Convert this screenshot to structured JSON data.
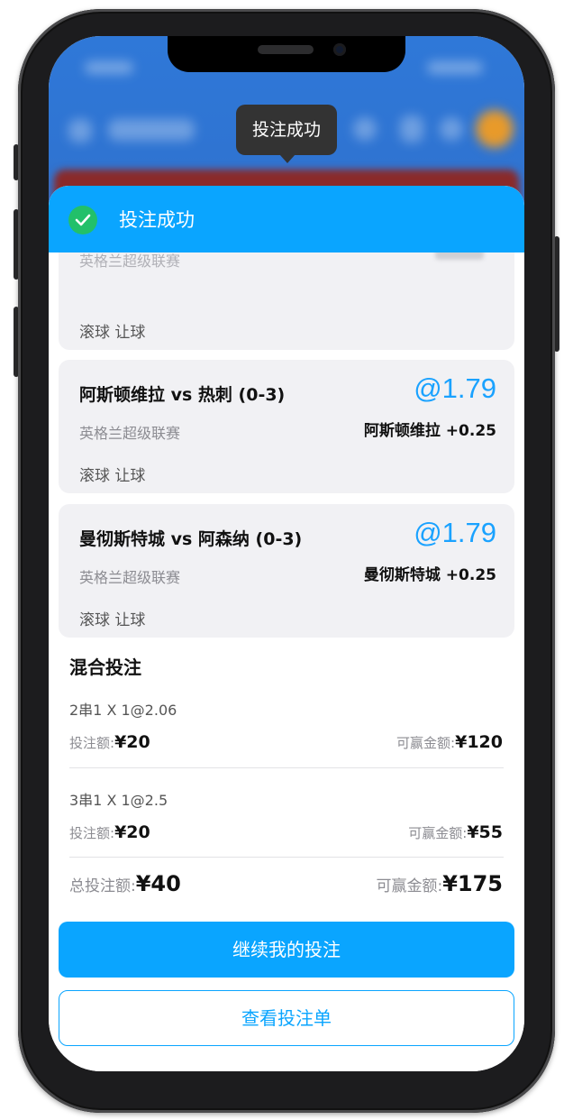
{
  "tooltip": {
    "text": "投注成功"
  },
  "sheet": {
    "title": "投注成功",
    "accent_color": "#0aa5ff",
    "success_color": "#22c06a"
  },
  "bets": [
    {
      "league": "英格兰超级联赛",
      "type": "滚球 让球"
    },
    {
      "match": "阿斯顿维拉 vs 热刺 (0-3)",
      "odds": "@1.79",
      "league": "英格兰超级联赛",
      "pick": "阿斯顿维拉 +0.25",
      "type": "滚球 让球"
    },
    {
      "match": "曼彻斯特城 vs 阿森纳 (0-3)",
      "odds": "@1.79",
      "league": "英格兰超级联赛",
      "pick": "曼彻斯特城 +0.25",
      "type": "滚球 让球"
    }
  ],
  "combo": {
    "section_title": "混合投注",
    "items": [
      {
        "name": "2串1 X 1@2.06",
        "stake_label": "投注额:",
        "stake_value": "¥20",
        "win_label": "可赢金额:",
        "win_value": "¥120"
      },
      {
        "name": "3串1 X 1@2.5",
        "stake_label": "投注额:",
        "stake_value": "¥20",
        "win_label": "可赢金额:",
        "win_value": "¥55"
      }
    ],
    "total_stake_label": "总投注额:",
    "total_stake_value": "¥40",
    "total_win_label": "可赢金额:",
    "total_win_value": "¥175"
  },
  "actions": {
    "continue_label": "继续我的投注",
    "view_label": "查看投注单"
  }
}
